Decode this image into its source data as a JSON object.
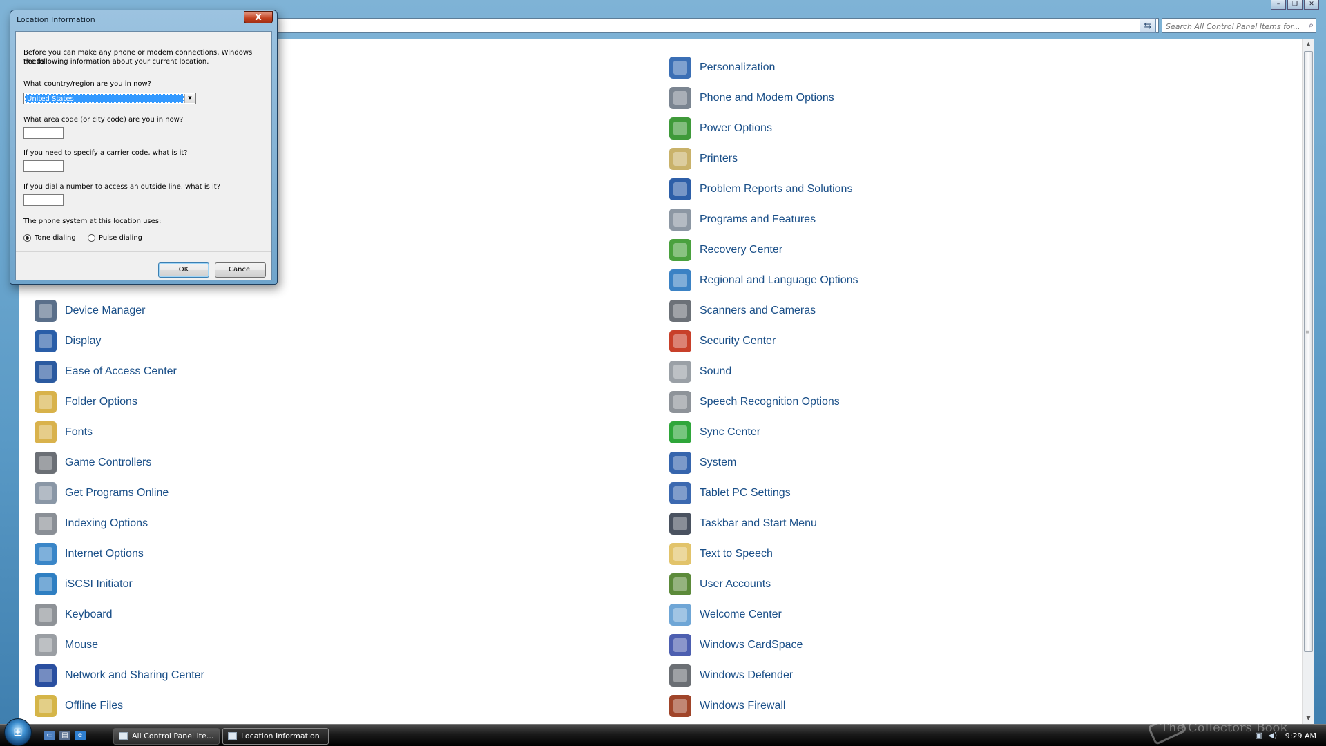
{
  "explorer": {
    "search_placeholder": "Search All Control Panel Items for...",
    "items_left": [
      {
        "label": "Device Manager",
        "icon": "device-manager-icon",
        "color": "#5a6f8a"
      },
      {
        "label": "Display",
        "icon": "display-icon",
        "color": "#2a5ea8"
      },
      {
        "label": "Ease of Access Center",
        "icon": "ease-of-access-icon",
        "color": "#2b5aa0"
      },
      {
        "label": "Folder Options",
        "icon": "folder-options-icon",
        "color": "#d8b24a"
      },
      {
        "label": "Fonts",
        "icon": "fonts-icon",
        "color": "#d9b24c"
      },
      {
        "label": "Game Controllers",
        "icon": "game-controllers-icon",
        "color": "#6b6f75"
      },
      {
        "label": "Get Programs Online",
        "icon": "get-programs-online-icon",
        "color": "#8a97a6"
      },
      {
        "label": "Indexing Options",
        "icon": "indexing-options-icon",
        "color": "#8a8f96"
      },
      {
        "label": "Internet Options",
        "icon": "internet-options-icon",
        "color": "#3a86c8"
      },
      {
        "label": "iSCSI Initiator",
        "icon": "iscsi-initiator-icon",
        "color": "#2f7fc2"
      },
      {
        "label": "Keyboard",
        "icon": "keyboard-icon",
        "color": "#8e9297"
      },
      {
        "label": "Mouse",
        "icon": "mouse-icon",
        "color": "#9a9ea3"
      },
      {
        "label": "Network and Sharing Center",
        "icon": "network-sharing-icon",
        "color": "#2a4fa0"
      },
      {
        "label": "Offline Files",
        "icon": "offline-files-icon",
        "color": "#d5b548"
      }
    ],
    "items_right": [
      {
        "label": "Personalization",
        "icon": "personalization-icon",
        "color": "#3b6fb5"
      },
      {
        "label": "Phone and Modem Options",
        "icon": "phone-modem-icon",
        "color": "#7b8591"
      },
      {
        "label": "Power Options",
        "icon": "power-options-icon",
        "color": "#3f9a3a"
      },
      {
        "label": "Printers",
        "icon": "printers-icon",
        "color": "#c9b26a"
      },
      {
        "label": "Problem Reports and Solutions",
        "icon": "problem-reports-icon",
        "color": "#2e5fa8"
      },
      {
        "label": "Programs and Features",
        "icon": "programs-features-icon",
        "color": "#8c97a3"
      },
      {
        "label": "Recovery Center",
        "icon": "recovery-center-icon",
        "color": "#4aa13e"
      },
      {
        "label": "Regional and Language Options",
        "icon": "regional-language-icon",
        "color": "#3b82c4"
      },
      {
        "label": "Scanners and Cameras",
        "icon": "scanners-cameras-icon",
        "color": "#6c7178"
      },
      {
        "label": "Security Center",
        "icon": "security-center-icon",
        "color": "#c8402a"
      },
      {
        "label": "Sound",
        "icon": "sound-icon",
        "color": "#9aa0a6"
      },
      {
        "label": "Speech Recognition Options",
        "icon": "speech-recognition-icon",
        "color": "#8e9399"
      },
      {
        "label": "Sync Center",
        "icon": "sync-center-icon",
        "color": "#2fa63a"
      },
      {
        "label": "System",
        "icon": "system-icon",
        "color": "#3665ad"
      },
      {
        "label": "Tablet PC Settings",
        "icon": "tablet-pc-icon",
        "color": "#3c69b0"
      },
      {
        "label": "Taskbar and Start Menu",
        "icon": "taskbar-start-menu-icon",
        "color": "#4a5260"
      },
      {
        "label": "Text to Speech",
        "icon": "text-to-speech-icon",
        "color": "#e2c36a"
      },
      {
        "label": "User Accounts",
        "icon": "user-accounts-icon",
        "color": "#5c8a3a"
      },
      {
        "label": "Welcome Center",
        "icon": "welcome-center-icon",
        "color": "#6fa6d6"
      },
      {
        "label": "Windows CardSpace",
        "icon": "cardspace-icon",
        "color": "#4d5fb0"
      },
      {
        "label": "Windows Defender",
        "icon": "windows-defender-icon",
        "color": "#6b6f74"
      },
      {
        "label": "Windows Firewall",
        "icon": "windows-firewall-icon",
        "color": "#a0452a"
      }
    ]
  },
  "dialog": {
    "title": "Location Information",
    "close_label": "X",
    "intro_line1": "Before you can make any phone or modem connections, Windows needs",
    "intro_line2": "the following information about your current location.",
    "country_label": "What country/region are you in now?",
    "country_value": "United States",
    "area_code_label": "What area code (or city code) are you in now?",
    "area_code_value": "",
    "carrier_label": "If you need to specify a carrier code, what is it?",
    "carrier_value": "",
    "outside_line_label": "If you dial a number to access an outside line, what is it?",
    "outside_line_value": "",
    "phone_system_label": "The phone system at this location uses:",
    "tone_label": "Tone dialing",
    "pulse_label": "Pulse dialing",
    "tone_selected": true,
    "ok_label": "OK",
    "cancel_label": "Cancel"
  },
  "taskbar": {
    "tasks": [
      {
        "label": "All Control Panel Ite...",
        "active": false
      },
      {
        "label": "Location Information",
        "active": true
      }
    ],
    "clock": "9:29 AM",
    "watermark": "The Collectors Book"
  }
}
